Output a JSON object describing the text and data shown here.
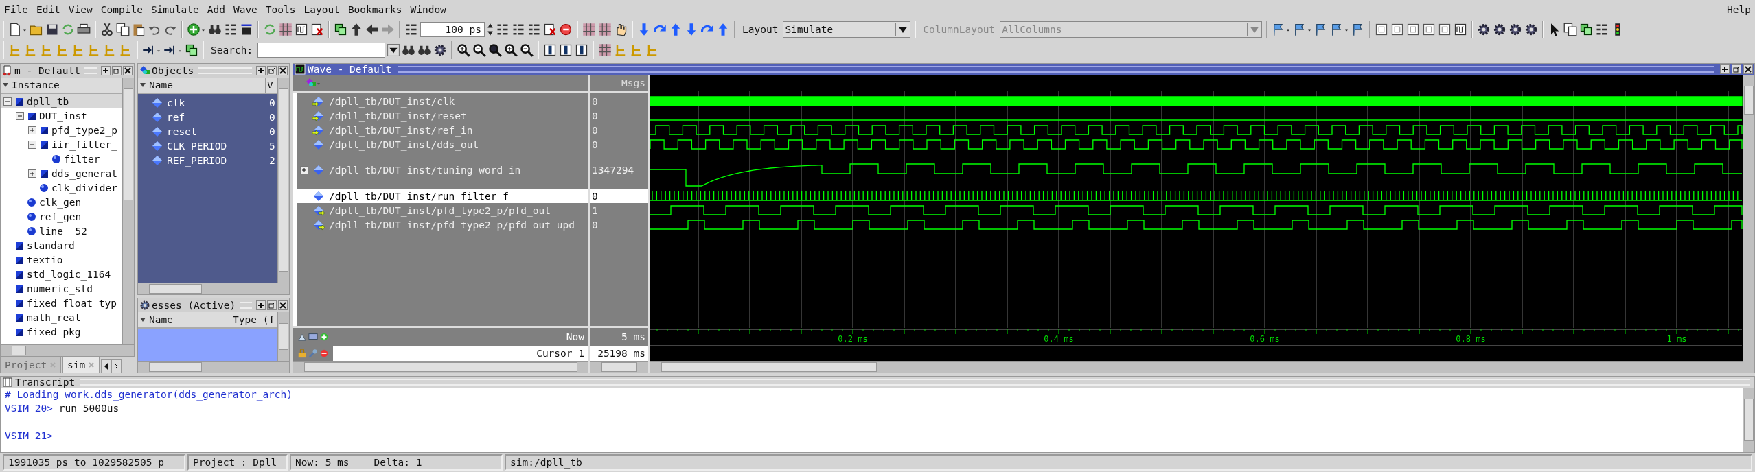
{
  "menu": [
    "File",
    "Edit",
    "View",
    "Compile",
    "Simulate",
    "Add",
    "Wave",
    "Tools",
    "Layout",
    "Bookmarks",
    "Window"
  ],
  "help": "Help",
  "toolbar": {
    "time_step": "100 ps",
    "layout_label": "Layout",
    "layout_value": "Simulate",
    "column_layout_label": "ColumnLayout",
    "column_layout_value": "AllColumns",
    "column_layout_disabled": true,
    "search_label": "Search:"
  },
  "structure_panel": {
    "title": "m - Default",
    "column": "Instance",
    "items": [
      {
        "label": "dpll_tb",
        "kind": "instance",
        "selected": true,
        "expanded": true,
        "children": [
          {
            "label": "DUT_inst",
            "kind": "instance",
            "selected": false,
            "expanded": true,
            "children": [
              {
                "label": "pfd_type2_p",
                "kind": "instance",
                "selected": false,
                "expanded": false
              },
              {
                "label": "iir_filter_",
                "kind": "instance",
                "selected": false,
                "expanded": true,
                "children": [
                  {
                    "label": "filter",
                    "kind": "process",
                    "selected": false
                  }
                ]
              },
              {
                "label": "dds_generat",
                "kind": "instance",
                "selected": false,
                "expanded": false
              },
              {
                "label": "clk_divider",
                "kind": "process",
                "selected": false
              }
            ]
          },
          {
            "label": "clk_gen",
            "kind": "process",
            "selected": false
          },
          {
            "label": "ref_gen",
            "kind": "process",
            "selected": false
          },
          {
            "label": "line__52",
            "kind": "process",
            "selected": false
          }
        ]
      },
      {
        "label": "standard",
        "kind": "instance",
        "selected": false
      },
      {
        "label": "textio",
        "kind": "instance",
        "selected": false
      },
      {
        "label": "std_logic_1164",
        "kind": "instance",
        "selected": false
      },
      {
        "label": "numeric_std",
        "kind": "instance",
        "selected": false
      },
      {
        "label": "fixed_float_typ",
        "kind": "instance",
        "selected": false
      },
      {
        "label": "math_real",
        "kind": "instance",
        "selected": false
      },
      {
        "label": "fixed_pkg",
        "kind": "instance",
        "selected": false
      }
    ]
  },
  "tabs": [
    {
      "label": "Project",
      "selected": false
    },
    {
      "label": "sim",
      "selected": true
    }
  ],
  "objects_panel": {
    "title": "Objects",
    "columns": [
      "Name",
      "V"
    ],
    "rows": [
      {
        "name": "clk",
        "value": "0",
        "selected": false
      },
      {
        "name": "ref",
        "value": "0",
        "selected": false
      },
      {
        "name": "reset",
        "value": "0",
        "selected": false
      },
      {
        "name": "CLK_PERIOD",
        "value": "5",
        "selected": false
      },
      {
        "name": "REF_PERIOD",
        "value": "2",
        "selected": false
      }
    ]
  },
  "processes_panel": {
    "title": "esses (Active)",
    "columns": [
      "Name",
      "Type (f"
    ]
  },
  "wave": {
    "title": "Wave - Default",
    "msgs_header": "Msgs",
    "signals": [
      {
        "name": "/dpll_tb/DUT_inst/clk",
        "value": "0",
        "is_input": true,
        "is_output": false,
        "kind": "clock",
        "selected": false
      },
      {
        "name": "/dpll_tb/DUT_inst/reset",
        "value": "0",
        "is_input": true,
        "is_output": false,
        "kind": "constant",
        "selected": false
      },
      {
        "name": "/dpll_tb/DUT_inst/ref_in",
        "value": "0",
        "is_input": true,
        "is_output": false,
        "kind": "logic",
        "selected": false
      },
      {
        "name": "/dpll_tb/DUT_inst/dds_out",
        "value": "0",
        "is_input": false,
        "is_output": false,
        "kind": "logic",
        "selected": false
      },
      {
        "name": "/dpll_tb/DUT_inst/tuning_word_in",
        "value": "1347294",
        "is_input": false,
        "is_output": false,
        "kind": "analog",
        "expanded": false,
        "selected": false
      },
      {
        "name": "/dpll_tb/DUT_inst/run_filter_f",
        "value": "0",
        "is_input": false,
        "is_output": false,
        "kind": "pulse_train",
        "selected": true
      },
      {
        "name": "/dpll_tb/DUT_inst/pfd_type2_p/pfd_out",
        "value": "1",
        "is_input": false,
        "is_output": true,
        "kind": "logic",
        "selected": false
      },
      {
        "name": "/dpll_tb/DUT_inst/pfd_type2_p/pfd_out_upd",
        "value": "0",
        "is_input": false,
        "is_output": true,
        "kind": "logic",
        "selected": false
      }
    ],
    "now_label": "Now",
    "now_value": "5 ms",
    "cursor_label": "Cursor 1",
    "cursor_value": "25198 ms",
    "time_labels": [
      "0.2 ms",
      "0.4 ms",
      "0.6 ms",
      "0.8 ms",
      "1 ms"
    ]
  },
  "transcript": {
    "title": "Transcript",
    "lines": [
      {
        "kind": "comment",
        "text": "# Loading work.dds_generator(dds_generator_arch)"
      },
      {
        "kind": "prompt",
        "prompt": "VSIM 20>",
        "command": "run 5000us"
      },
      {
        "kind": "blank"
      },
      {
        "kind": "prompt",
        "prompt": "VSIM 21>"
      }
    ]
  },
  "status_bar": [
    {
      "texts": [
        "1991035 ps to 1029582505 p"
      ]
    },
    {
      "texts": [
        "Project : Dpll"
      ]
    },
    {
      "texts": [
        "Now: 5 ms",
        "Delta: 1"
      ]
    },
    {
      "texts": [
        "sim:/dpll_tb"
      ]
    }
  ]
}
